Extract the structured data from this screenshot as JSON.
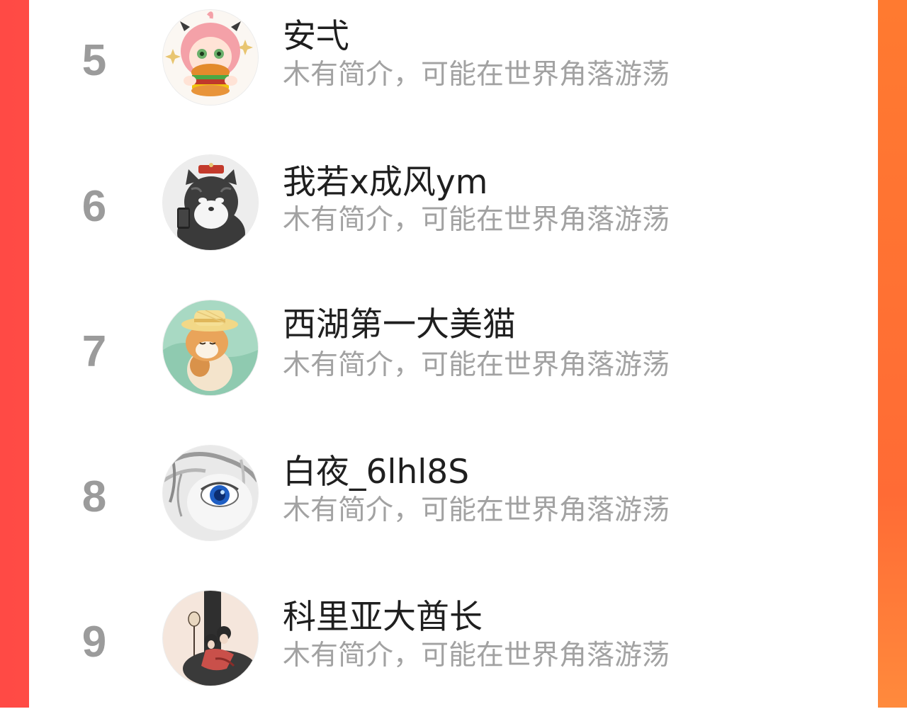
{
  "ranking": {
    "entries": [
      {
        "rank": "5",
        "name": "安弌",
        "bio": "木有简介，可能在世界角落游荡",
        "avatar_icon": "anime-girl-burger-avatar"
      },
      {
        "rank": "6",
        "name": "我若x成风ym",
        "bio": "木有简介，可能在世界角落游荡",
        "avatar_icon": "cat-with-phone-avatar"
      },
      {
        "rank": "7",
        "name": "西湖第一大美猫",
        "bio": "木有简介，可能在世界角落游荡",
        "avatar_icon": "cat-straw-hat-avatar"
      },
      {
        "rank": "8",
        "name": "白夜_6lhl8S",
        "bio": "木有简介，可能在世界角落游荡",
        "avatar_icon": "blue-eye-sketch-avatar"
      },
      {
        "rank": "9",
        "name": "科里亚大酋长",
        "bio": "木有简介，可能在世界角落游荡",
        "avatar_icon": "ancient-couple-lantern-avatar"
      }
    ]
  },
  "colors": {
    "background_left": "#ff4a45",
    "background_right": "#ff8a33",
    "card": "#ffffff",
    "rank_text": "#9b9b9b",
    "name_text": "#1f1f1f",
    "bio_text": "#a2a2a2"
  }
}
